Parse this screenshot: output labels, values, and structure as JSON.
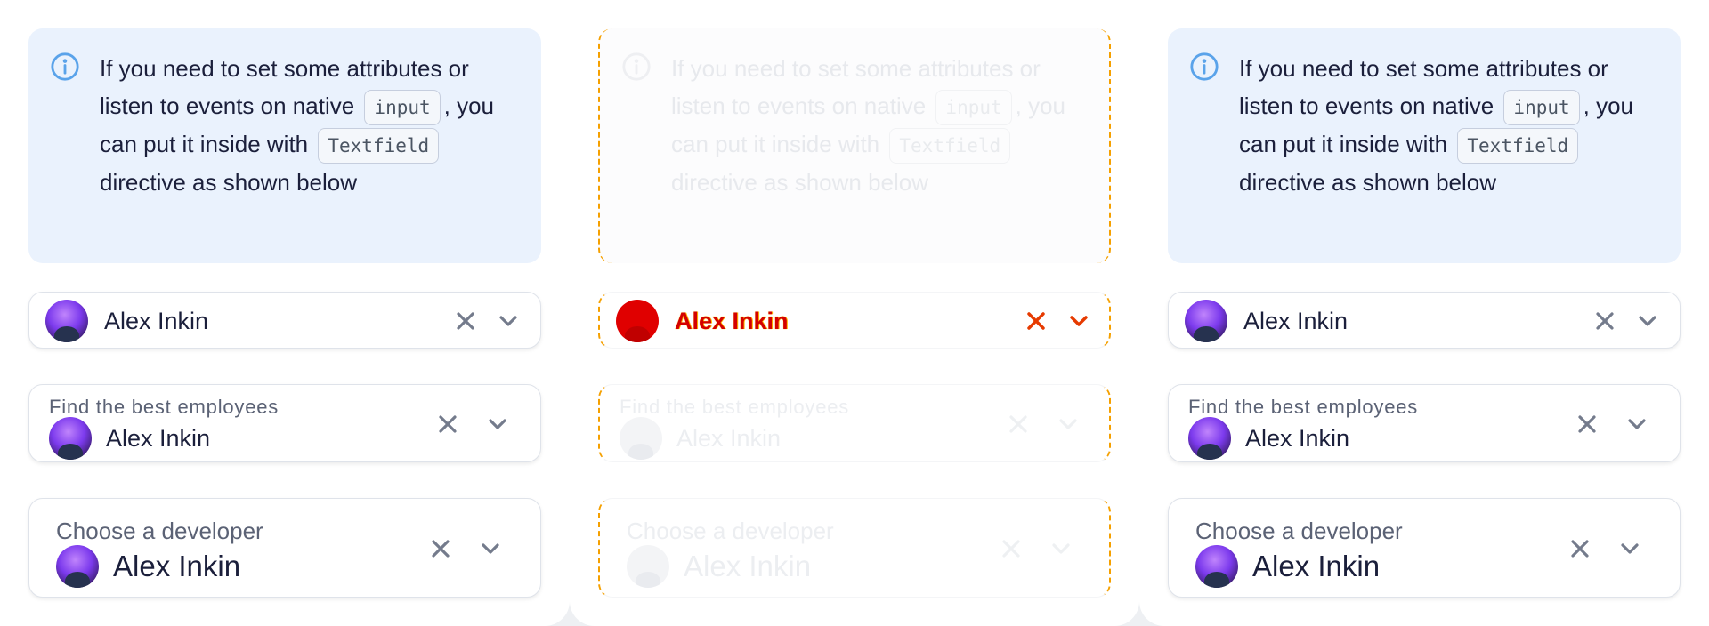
{
  "notice": {
    "text_before": "If you need to set some attributes or listen to events on native",
    "code1": "input",
    "text_middle": ", you can put it inside with",
    "code2": "Textfield",
    "text_after": "directive as shown below"
  },
  "fields": {
    "compact": {
      "value": "Alex Inkin"
    },
    "labeled": {
      "label": "Find the best employees",
      "value": "Alex Inkin"
    },
    "large": {
      "label": "Choose a developer",
      "value": "Alex Inkin"
    }
  },
  "icons": {
    "info": "info-circle-icon",
    "clear": "close-icon",
    "chevron": "chevron-down-icon"
  },
  "colors": {
    "notice_bg": "#eaf2fd",
    "info_icon": "#5aa3ea",
    "text": "#1b1f3b",
    "icon_gray": "#747b8c",
    "diff_red": "#d40000"
  }
}
